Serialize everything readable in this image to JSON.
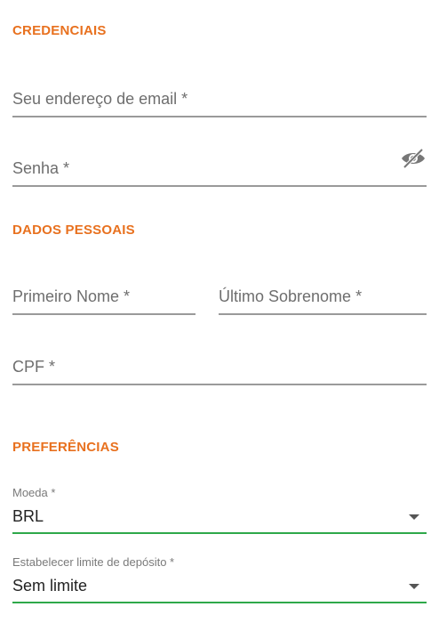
{
  "credentials": {
    "title": "CREDENCIAIS",
    "email_placeholder": "Seu endereço de email *",
    "password_placeholder": "Senha *",
    "password_toggle_icon": "eye-off-icon"
  },
  "personal": {
    "title": "DADOS PESSOAIS",
    "first_name_placeholder": "Primeiro Nome *",
    "last_name_placeholder": "Último Sobrenome *",
    "cpf_placeholder": "CPF *"
  },
  "preferences": {
    "title": "PREFERÊNCIAS",
    "currency_label": "Moeda *",
    "currency_value": "BRL",
    "deposit_limit_label": "Estabelecer limite de depósito *",
    "deposit_limit_value": "Sem limite"
  },
  "colors": {
    "accent": "#e8711f",
    "field_line": "#9a9a9a",
    "select_line": "#2ea84a"
  }
}
